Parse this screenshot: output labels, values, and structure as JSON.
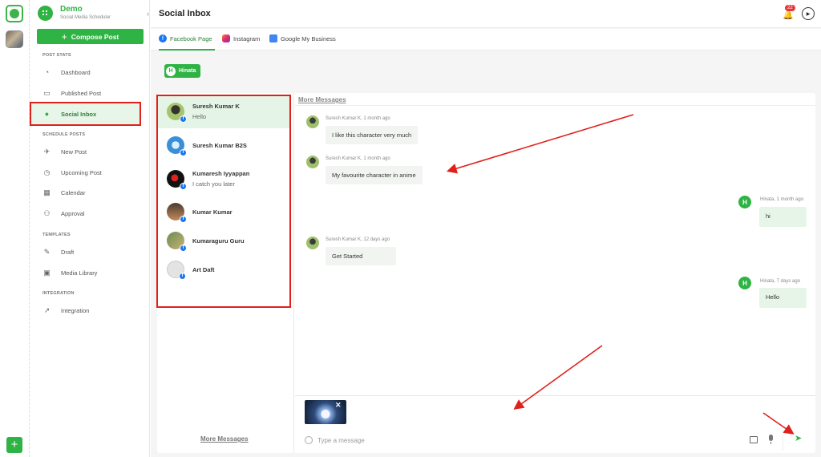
{
  "workspace_rail": {
    "add_label": "+"
  },
  "brand": {
    "name": "Demo",
    "subtitle": "Social Media Scheduler",
    "collapse": "‹"
  },
  "sidebar": {
    "compose_label": "Compose Post",
    "compose_icon": "+",
    "sections": {
      "post_stats": "POST STATS",
      "schedule_posts": "SCHEDULE POSTS",
      "templates": "TEMPLATES",
      "integration": "INTEGRATION"
    },
    "items": [
      {
        "label": "Dashboard",
        "icon": "dashboard-icon"
      },
      {
        "label": "Published Post",
        "icon": "published-icon"
      },
      {
        "label": "Social Inbox",
        "icon": "inbox-icon",
        "active": true
      },
      {
        "label": "New Post",
        "icon": "new-post-icon"
      },
      {
        "label": "Upcoming Post",
        "icon": "upcoming-icon"
      },
      {
        "label": "Calendar",
        "icon": "calendar-icon"
      },
      {
        "label": "Approval",
        "icon": "approval-icon"
      },
      {
        "label": "Draft",
        "icon": "draft-icon"
      },
      {
        "label": "Media Library",
        "icon": "media-library-icon"
      },
      {
        "label": "Integration",
        "icon": "integration-icon"
      }
    ]
  },
  "header": {
    "title": "Social Inbox",
    "notification_count": "22",
    "profile_icon": "▶"
  },
  "tabs": [
    {
      "label": "Facebook Page",
      "icon": "facebook-icon",
      "active": true
    },
    {
      "label": "Instagram",
      "icon": "instagram-icon"
    },
    {
      "label": "Google My Business",
      "icon": "google-business-icon"
    }
  ],
  "account_chip": {
    "initial": "H",
    "label": "Hinata"
  },
  "conversations": [
    {
      "name": "Suresh Kumar K",
      "preview": "Hello",
      "active": true
    },
    {
      "name": "Suresh Kumar B2S",
      "preview": ""
    },
    {
      "name": "Kumaresh Iyyappan",
      "preview": "I catch you later"
    },
    {
      "name": "Kumar Kumar",
      "preview": ""
    },
    {
      "name": "Kumaraguru Guru",
      "preview": ""
    },
    {
      "name": "Art Daft",
      "preview": ""
    }
  ],
  "conversation_more": "More Messages",
  "thread": {
    "more": "More Messages",
    "messages": [
      {
        "meta": "Suresh Kumar K,  1 month ago",
        "text": "I like this character very much",
        "direction": "in"
      },
      {
        "meta": "Suresh Kumar K,  1 month ago",
        "text": "My favourite character in anime",
        "direction": "in"
      },
      {
        "meta": "Hinata, 1 month ago",
        "text": "hi",
        "direction": "out",
        "initial": "H"
      },
      {
        "meta": "Suresh Kumar K,  12 days ago",
        "text": "Get Started",
        "direction": "in"
      },
      {
        "meta": "Hinata, 7 days ago",
        "text": "Hello",
        "direction": "out",
        "initial": "H"
      }
    ]
  },
  "composer": {
    "placeholder": "Type a message",
    "remove_attachment": "✕",
    "send_icon": "➤"
  },
  "colors": {
    "accent": "#2fb344",
    "highlight_red": "#e0201b",
    "facebook": "#1877f2"
  }
}
